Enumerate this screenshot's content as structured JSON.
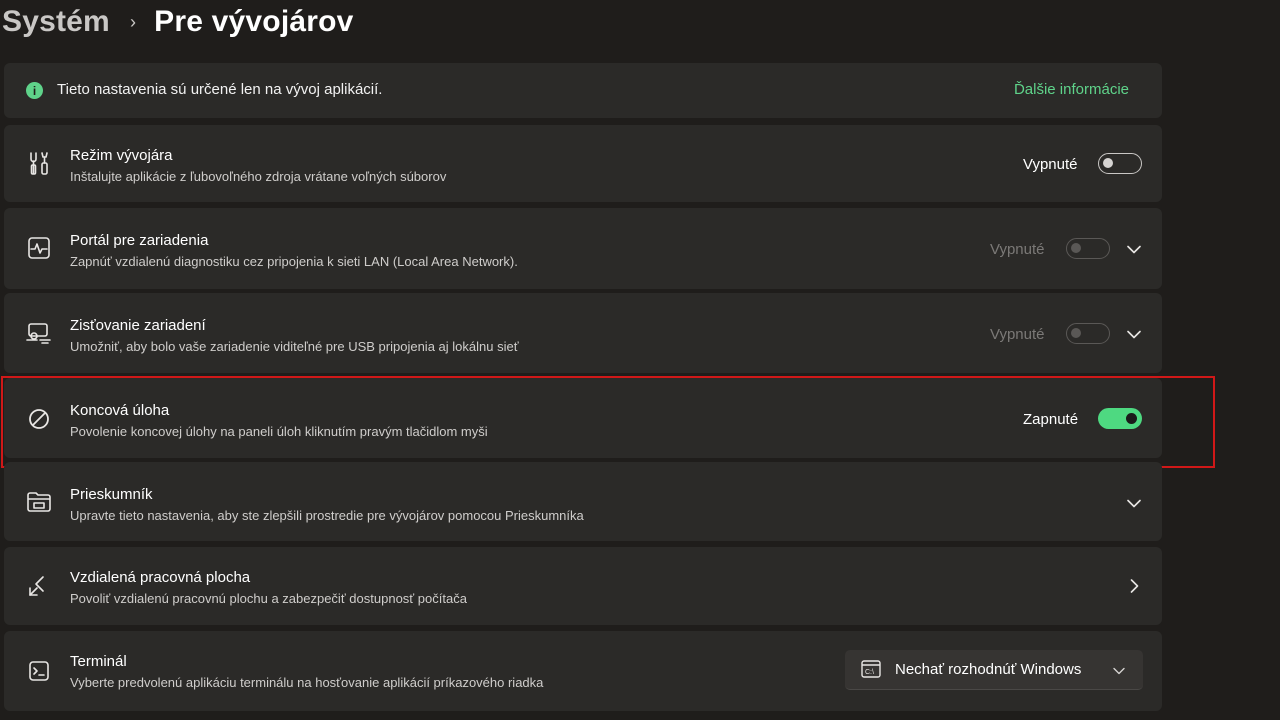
{
  "breadcrumb": {
    "parent": "Systém",
    "separator": "›",
    "current": "Pre vývojárov"
  },
  "info_banner": {
    "icon": "info-icon",
    "icon_glyph": "i",
    "text": "Tieto nastavenia sú určené len na vývoj aplikácií.",
    "link": "Ďalšie informácie"
  },
  "rows": [
    {
      "icon": "developer-tools-icon",
      "title": "Režim vývojára",
      "subtitle": "Inštalujte aplikácie z ľubovoľného zdroja vrátane voľných súborov",
      "state": "Vypnuté",
      "toggle": "off"
    },
    {
      "icon": "device-portal-icon",
      "title": "Portál pre zariadenia",
      "subtitle": "Zapnúť vzdialenú diagnostiku cez pripojenia k sieti LAN (Local Area Network).",
      "state": "Vypnuté",
      "toggle": "disabled"
    },
    {
      "icon": "device-discovery-icon",
      "title": "Zisťovanie zariadení",
      "subtitle": "Umožniť, aby bolo vaše zariadenie viditeľné pre USB pripojenia aj lokálnu sieť",
      "state": "Vypnuté",
      "toggle": "disabled"
    },
    {
      "icon": "end-task-icon",
      "title": "Koncová úloha",
      "subtitle": "Povolenie koncovej úlohy na paneli úloh kliknutím pravým tlačidlom myši",
      "state": "Zapnuté",
      "toggle": "on"
    },
    {
      "icon": "file-explorer-icon",
      "title": "Prieskumník",
      "subtitle": "Upravte tieto nastavenia, aby ste zlepšili prostredie pre vývojárov pomocou Prieskumníka"
    },
    {
      "icon": "remote-desktop-icon",
      "title": "Vzdialená pracovná plocha",
      "subtitle": "Povoliť vzdialenú pracovnú plochu a zabezpečiť dostupnosť počítača"
    },
    {
      "icon": "terminal-icon",
      "title": "Terminál",
      "subtitle": "Vyberte predvolenú aplikáciu terminálu na hosťovanie aplikácií príkazového riadka",
      "dropdown": {
        "icon": "terminal-app-icon",
        "value": "Nechať rozhodnúť Windows"
      }
    }
  ],
  "colors": {
    "background": "#1f1d1b",
    "card": "#2b2a28",
    "accent": "#4ed981",
    "highlight_border": "#d01818"
  }
}
